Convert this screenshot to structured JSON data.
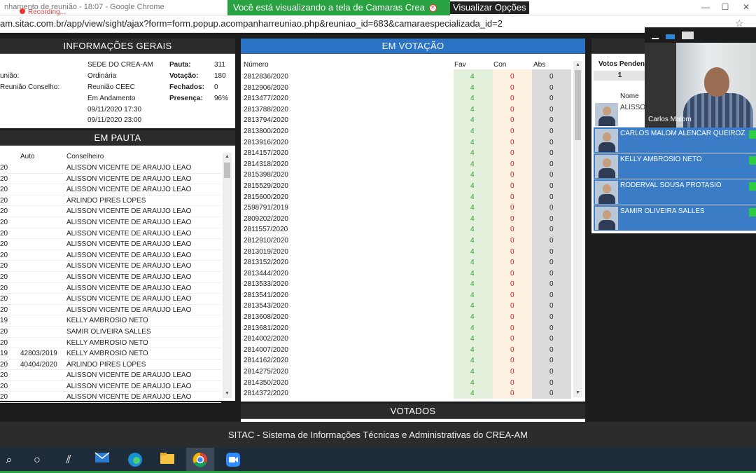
{
  "browser": {
    "title": "nhamento de reunião - 18:07 - Google Chrome",
    "recording_label": "Recording...",
    "url": "am.sitac.com.br/app/view/sight/ajax?form=form.popup.acompanharreuniao.php&reuniao_id=683&camaraespecializada_id=2",
    "banner_text": "Você está visualizando a tela de Camaras Crea",
    "view_options": "Visualizar Opções"
  },
  "info": {
    "heading": "INFORMAÇÕES GERAIS",
    "labels": [
      "união:",
      "Reunião Conselho:"
    ],
    "values": [
      "SEDE DO CREA-AM",
      "Ordinária",
      "Reunião CEEC",
      "Em Andamento",
      "09/11/2020 17:30",
      "09/11/2020 23:00"
    ],
    "stats": [
      {
        "label": "Pauta:",
        "value": "311"
      },
      {
        "label": "Votação:",
        "value": "180"
      },
      {
        "label": "Fechados:",
        "value": "0"
      },
      {
        "label": "Presença:",
        "value": "96%"
      }
    ]
  },
  "pauta": {
    "heading": "EM PAUTA",
    "col_auto": "Auto",
    "col_conselheiro": "Conselheiro",
    "rows": [
      {
        "yr": "20",
        "auto": "",
        "name": "ALISSON VICENTE DE ARAUJO LEAO"
      },
      {
        "yr": "20",
        "auto": "",
        "name": "ALISSON VICENTE DE ARAUJO LEAO"
      },
      {
        "yr": "20",
        "auto": "",
        "name": "ALISSON VICENTE DE ARAUJO LEAO"
      },
      {
        "yr": "20",
        "auto": "",
        "name": "ARLINDO PIRES LOPES"
      },
      {
        "yr": "20",
        "auto": "",
        "name": "ALISSON VICENTE DE ARAUJO LEAO"
      },
      {
        "yr": "20",
        "auto": "",
        "name": "ALISSON VICENTE DE ARAUJO LEAO"
      },
      {
        "yr": "20",
        "auto": "",
        "name": "ALISSON VICENTE DE ARAUJO LEAO"
      },
      {
        "yr": "20",
        "auto": "",
        "name": "ALISSON VICENTE DE ARAUJO LEAO"
      },
      {
        "yr": "20",
        "auto": "",
        "name": "ALISSON VICENTE DE ARAUJO LEAO"
      },
      {
        "yr": "20",
        "auto": "",
        "name": "ALISSON VICENTE DE ARAUJO LEAO"
      },
      {
        "yr": "20",
        "auto": "",
        "name": "ALISSON VICENTE DE ARAUJO LEAO"
      },
      {
        "yr": "20",
        "auto": "",
        "name": "ALISSON VICENTE DE ARAUJO LEAO"
      },
      {
        "yr": "20",
        "auto": "",
        "name": "ALISSON VICENTE DE ARAUJO LEAO"
      },
      {
        "yr": "20",
        "auto": "",
        "name": "ALISSON VICENTE DE ARAUJO LEAO"
      },
      {
        "yr": "19",
        "auto": "",
        "name": "KELLY AMBROSIO NETO"
      },
      {
        "yr": "20",
        "auto": "",
        "name": "SAMIR OLIVEIRA SALLES"
      },
      {
        "yr": "20",
        "auto": "",
        "name": "KELLY AMBROSIO NETO"
      },
      {
        "yr": "19",
        "auto": "42803/2019",
        "name": "KELLY AMBROSIO NETO"
      },
      {
        "yr": "20",
        "auto": "40404/2020",
        "name": "ARLINDO PIRES LOPES"
      },
      {
        "yr": "20",
        "auto": "",
        "name": "ALISSON VICENTE DE ARAUJO LEAO"
      },
      {
        "yr": "20",
        "auto": "",
        "name": "ALISSON VICENTE DE ARAUJO LEAO"
      },
      {
        "yr": "20",
        "auto": "",
        "name": "ALISSON VICENTE DE ARAUJO LEAO"
      }
    ]
  },
  "votacao": {
    "heading": "EM VOTAÇÃO",
    "col_numero": "Número",
    "col_fav": "Fav",
    "col_con": "Con",
    "col_abs": "Abs",
    "rows": [
      {
        "num": "2812836/2020",
        "fav": "4",
        "con": "0",
        "abs": "0"
      },
      {
        "num": "2812906/2020",
        "fav": "4",
        "con": "0",
        "abs": "0"
      },
      {
        "num": "2813477/2020",
        "fav": "4",
        "con": "0",
        "abs": "0"
      },
      {
        "num": "2813788/2020",
        "fav": "4",
        "con": "0",
        "abs": "0"
      },
      {
        "num": "2813794/2020",
        "fav": "4",
        "con": "0",
        "abs": "0"
      },
      {
        "num": "2813800/2020",
        "fav": "4",
        "con": "0",
        "abs": "0"
      },
      {
        "num": "2813916/2020",
        "fav": "4",
        "con": "0",
        "abs": "0"
      },
      {
        "num": "2814157/2020",
        "fav": "4",
        "con": "0",
        "abs": "0"
      },
      {
        "num": "2814318/2020",
        "fav": "4",
        "con": "0",
        "abs": "0"
      },
      {
        "num": "2815398/2020",
        "fav": "4",
        "con": "0",
        "abs": "0"
      },
      {
        "num": "2815529/2020",
        "fav": "4",
        "con": "0",
        "abs": "0"
      },
      {
        "num": "2815600/2020",
        "fav": "4",
        "con": "0",
        "abs": "0"
      },
      {
        "num": "2598791/2019",
        "fav": "4",
        "con": "0",
        "abs": "0"
      },
      {
        "num": "2809202/2020",
        "fav": "4",
        "con": "0",
        "abs": "0"
      },
      {
        "num": "2811557/2020",
        "fav": "4",
        "con": "0",
        "abs": "0"
      },
      {
        "num": "2812910/2020",
        "fav": "4",
        "con": "0",
        "abs": "0"
      },
      {
        "num": "2813019/2020",
        "fav": "4",
        "con": "0",
        "abs": "0"
      },
      {
        "num": "2813152/2020",
        "fav": "4",
        "con": "0",
        "abs": "0"
      },
      {
        "num": "2813444/2020",
        "fav": "4",
        "con": "0",
        "abs": "0"
      },
      {
        "num": "2813533/2020",
        "fav": "4",
        "con": "0",
        "abs": "0"
      },
      {
        "num": "2813541/2020",
        "fav": "4",
        "con": "0",
        "abs": "0"
      },
      {
        "num": "2813543/2020",
        "fav": "4",
        "con": "0",
        "abs": "0"
      },
      {
        "num": "2813608/2020",
        "fav": "4",
        "con": "0",
        "abs": "0"
      },
      {
        "num": "2813681/2020",
        "fav": "4",
        "con": "0",
        "abs": "0"
      },
      {
        "num": "2814002/2020",
        "fav": "4",
        "con": "0",
        "abs": "0"
      },
      {
        "num": "2814007/2020",
        "fav": "4",
        "con": "0",
        "abs": "0"
      },
      {
        "num": "2814162/2020",
        "fav": "4",
        "con": "0",
        "abs": "0"
      },
      {
        "num": "2814275/2020",
        "fav": "4",
        "con": "0",
        "abs": "0"
      },
      {
        "num": "2814350/2020",
        "fav": "4",
        "con": "0",
        "abs": "0"
      },
      {
        "num": "2814372/2020",
        "fav": "4",
        "con": "0",
        "abs": "0"
      }
    ]
  },
  "votados": {
    "heading": "VOTADOS"
  },
  "votos": {
    "pendentes_label": "Votos Penden",
    "pendentes_value": "1",
    "col_nome": "Nome",
    "voters": [
      {
        "name": "ALISSO",
        "highlight": false
      },
      {
        "name": "CARLOS MALOM ALENCAR QUEIROZ",
        "highlight": true
      },
      {
        "name": "KELLY AMBROSIO NETO",
        "highlight": true
      },
      {
        "name": "RODERVAL SOUSA PROTASIO",
        "highlight": true
      },
      {
        "name": "SAMIR OLIVEIRA SALLES",
        "highlight": true
      }
    ]
  },
  "webcam": {
    "label": "Carlos Malom"
  },
  "footer": {
    "text": "SITAC - Sistema de Informações Técnicas e Administrativas do CREA-AM"
  },
  "taskbar": {
    "icons": [
      "search-icon",
      "task-view-icon",
      "widgets-icon",
      "mail-icon",
      "edge-icon",
      "file-explorer-icon",
      "chrome-icon",
      "zoom-icon"
    ]
  },
  "colors": {
    "accent_green": "#29a342",
    "header_blue": "#2a73c5",
    "fav_bg": "#e3f1dc",
    "con_bg": "#fdf2e2",
    "abs_bg": "#dcdcdc",
    "fav_text": "#2ca02c",
    "con_text": "#e02020"
  }
}
